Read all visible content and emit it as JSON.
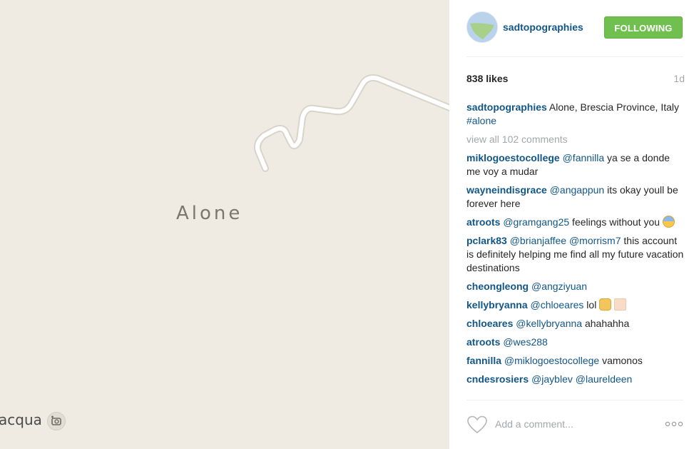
{
  "map": {
    "place_label": "Alone",
    "edge_town_label": "acqua",
    "camera_icon": "camera-plus-icon"
  },
  "post": {
    "username": "sadtopographies",
    "follow_label": "FOLLOWING",
    "likes": "838 likes",
    "age": "1d",
    "caption": {
      "user": "sadtopographies",
      "text": " Alone, Brescia Province, Italy ",
      "hashtag": "#alone"
    },
    "view_all_comments": "view all 102 comments",
    "comments": [
      {
        "user": "miklogoestocollege",
        "mention": "@fannilla",
        "text": " ya se a donde me voy a mudar"
      },
      {
        "user": "wayneindisgrace",
        "mention": "@angappun",
        "text": " its okay youll be forever here"
      },
      {
        "user": "atroots",
        "mention": "@gramgang25",
        "text": " feelings without you "
      },
      {
        "user": "pclark83",
        "mention": "@brianjaffee @morrism7",
        "text": " this account is definitely helping me find all my future vacation destinations"
      },
      {
        "user": "cheongleong",
        "mention": "@angziyuan",
        "text": ""
      },
      {
        "user": "kellybryanna",
        "mention": "@chloeares",
        "text": " lol "
      },
      {
        "user": "chloeares",
        "mention": "@kellybryanna",
        "text": " ahahahha"
      },
      {
        "user": "atroots",
        "mention": "@wes288",
        "text": ""
      },
      {
        "user": "fannilla",
        "mention": "@miklogoestocollege",
        "text": " vamonos"
      },
      {
        "user": "cndesrosiers",
        "mention": "@jayblev @laureldeen",
        "text": ""
      }
    ],
    "add_comment_placeholder": "Add a comment...",
    "icons": {
      "like": "heart-icon",
      "more": "more-dots-icon"
    }
  },
  "colors": {
    "link": "#125688",
    "follow_button": "#70c050",
    "map_background": "#efebe3"
  }
}
